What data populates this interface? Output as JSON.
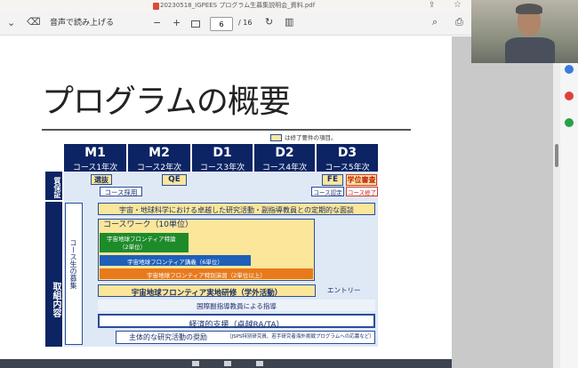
{
  "browser": {
    "filename": "20230518_IGPEES プログラム生募集説明会_資料.pdf",
    "read_aloud": "音声で読み上げる",
    "zoom_out": "−",
    "zoom_in": "+",
    "page_current": "6",
    "page_total": "/ 16"
  },
  "slide": {
    "title": "プログラムの概要",
    "legend": "は修了要件の項目。",
    "columns": [
      {
        "code": "M1",
        "year": "コース1年次"
      },
      {
        "code": "M2",
        "year": "コース2年次"
      },
      {
        "code": "D1",
        "year": "コース3年次"
      },
      {
        "code": "D2",
        "year": "コース4年次"
      },
      {
        "code": "D3",
        "year": "コース5年次"
      }
    ],
    "side_quality": "質保証",
    "side_activities": "取組内容",
    "side_recruit": "コース生の募集",
    "senbatsu": "選抜",
    "course_saiyo": "コース採用",
    "qe": "QE",
    "fe": "FE",
    "gakui": "学位審査",
    "course_nintei": "コース認定",
    "course_shuryo": "コース修了",
    "mentoring": "宇宙・地球科学における卓越した研究活動・副指導教員との定期的な面談",
    "coursework": "コースワーク（10単位）",
    "frontier_tokukou": "宇宙地球フロンティア特論",
    "tokukou_units": "（2単位）",
    "frontier_kougi": "宇宙地球フロンティア講義（6単位）",
    "frontier_enshu": "宇宙地球フロンティア特別演習（2単位以上）",
    "kensyu": "宇宙地球フロンティア実地研修（学外活動）",
    "entry": "エントリー",
    "kokusai": "国際副指導教員による指導",
    "keizai": "経済的支援（卓越RA/TA）",
    "shourei": "主体的な研究活動の奨励",
    "shourei_note": "（JSPS特別研究員、若手研究者海外挑戦プログラムへの応募など）"
  }
}
